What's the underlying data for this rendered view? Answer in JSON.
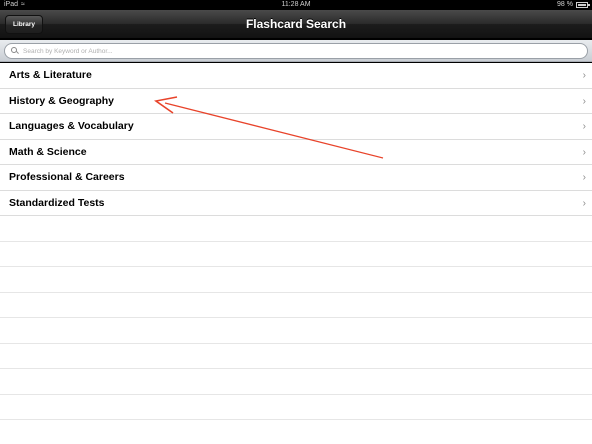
{
  "status_bar": {
    "carrier": "iPad",
    "time": "11:28 AM",
    "battery_percent": "98 %",
    "wifi_icon": "wifi-icon",
    "battery_icon": "battery-icon"
  },
  "nav_bar": {
    "title": "Flashcard Search",
    "back_button_label": "Library"
  },
  "search": {
    "placeholder": "Search by Keyword or Author...",
    "value": "",
    "icon": "search-icon"
  },
  "categories": [
    {
      "label": "Arts & Literature"
    },
    {
      "label": "History & Geography"
    },
    {
      "label": "Languages & Vocabulary"
    },
    {
      "label": "Math & Science"
    },
    {
      "label": "Professional & Careers"
    },
    {
      "label": "Standardized Tests"
    }
  ],
  "chevron_glyph": "›",
  "annotation": {
    "type": "arrow",
    "color": "#e8432a"
  }
}
